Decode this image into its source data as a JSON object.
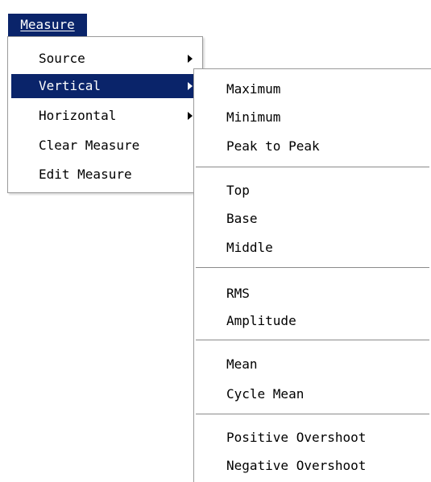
{
  "colors": {
    "highlight": "#0a246a",
    "highlight_text": "#ffffff",
    "menu_text": "#000000"
  },
  "menubar": {
    "title": "Measure"
  },
  "dropdown": {
    "items": [
      {
        "label": "Source",
        "has_submenu": true
      },
      {
        "label": "Vertical",
        "has_submenu": true,
        "selected": true
      },
      {
        "label": "Horizontal",
        "has_submenu": true
      },
      {
        "label": "Clear Measure",
        "has_submenu": false
      },
      {
        "label": "Edit Measure",
        "has_submenu": false
      }
    ]
  },
  "submenu": {
    "groups": [
      [
        "Maximum",
        "Minimum",
        "Peak to Peak"
      ],
      [
        "Top",
        "Base",
        "Middle"
      ],
      [
        "RMS",
        "Amplitude"
      ],
      [
        "Mean",
        "Cycle Mean"
      ],
      [
        "Positive Overshoot",
        "Negative Overshoot"
      ]
    ]
  },
  "icons": {
    "submenu_arrow": "triangle-right-icon"
  }
}
